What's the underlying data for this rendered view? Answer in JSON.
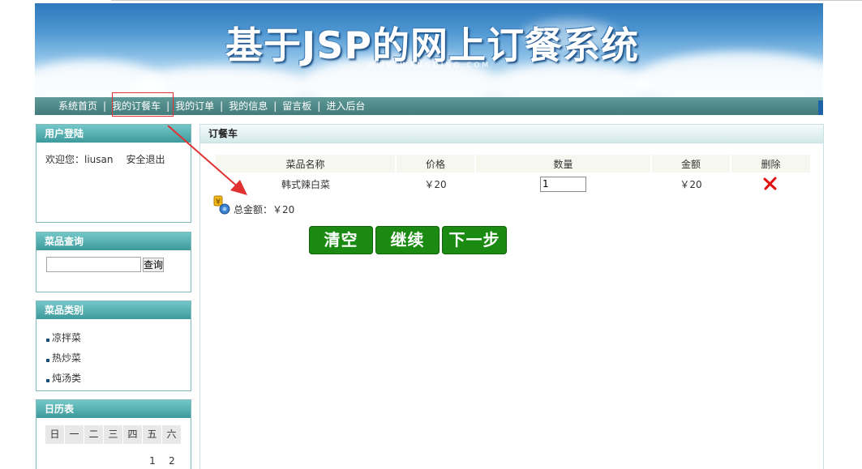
{
  "banner": {
    "title": "基于JSP的网上订餐系统",
    "subtitle": "WWW.WANGDING.COM"
  },
  "nav": {
    "items": [
      {
        "label": "系统首页"
      },
      {
        "label": "我的订餐车"
      },
      {
        "label": "我的订单"
      },
      {
        "label": "我的信息"
      },
      {
        "label": "留言板"
      },
      {
        "label": "进入后台"
      }
    ],
    "separator": "|"
  },
  "sidebar": {
    "login": {
      "title": "用户登陆",
      "welcome": "欢迎您：",
      "username": "liusan",
      "logout": "安全退出"
    },
    "search": {
      "title": "菜品查询",
      "input_value": "",
      "button": "查询"
    },
    "categories": {
      "title": "菜品类别",
      "items": [
        "凉拌菜",
        "热炒菜",
        "炖汤类"
      ]
    },
    "calendar": {
      "title": "日历表",
      "weekdays": [
        "日",
        "一",
        "二",
        "三",
        "四",
        "五",
        "六"
      ],
      "first_row": [
        "",
        "",
        "",
        "",
        "",
        "1",
        "2"
      ]
    }
  },
  "cart": {
    "title": "订餐车",
    "columns": [
      "菜品名称",
      "价格",
      "数量",
      "金额",
      "删除"
    ],
    "rows": [
      {
        "name": "韩式辣白菜",
        "price": "￥20",
        "quantity": "1",
        "amount": "￥20"
      }
    ],
    "total_label": "总金额：",
    "total_value": "￥20",
    "buttons": {
      "clear": "清空",
      "continue": "继续",
      "next": "下一步"
    }
  },
  "colors": {
    "nav_bg": "#4f8a88",
    "box_head": "#4fb0b2",
    "button_green": "#1b8a12",
    "highlight_red": "#e03030",
    "delete_red": "#e01010"
  }
}
